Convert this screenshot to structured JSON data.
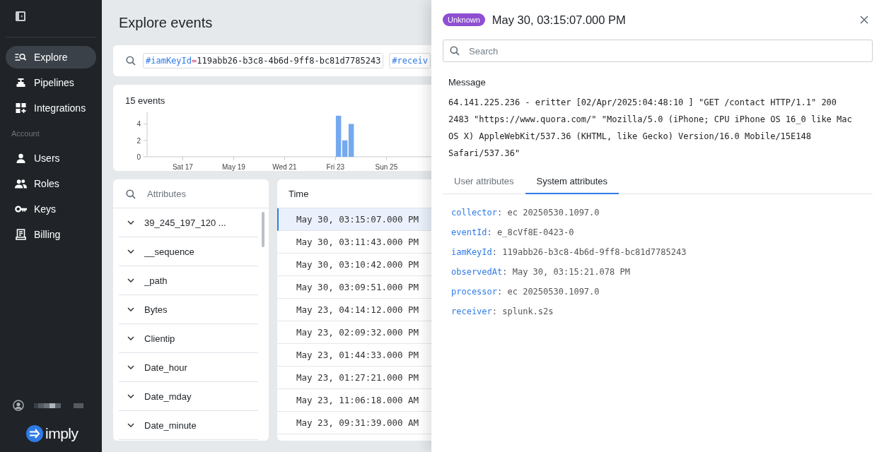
{
  "sidebar": {
    "items": [
      {
        "label": "Explore",
        "selected": true
      },
      {
        "label": "Pipelines",
        "selected": false
      },
      {
        "label": "Integrations",
        "selected": false
      }
    ],
    "section_label": "Account",
    "account_items": [
      {
        "label": "Users",
        "selected": false
      },
      {
        "label": "Roles",
        "selected": false
      },
      {
        "label": "Keys",
        "selected": false
      },
      {
        "label": "Billing",
        "selected": false
      }
    ],
    "logo": "imply"
  },
  "main": {
    "title": "Explore events",
    "filters": [
      {
        "key": "#iamKeyId",
        "op": "=",
        "value": "119abb26-b3c8-4b6d-9ff8-bc81d7785243"
      },
      {
        "key": "#receiv"
      }
    ],
    "histogram": {
      "count": "15 events",
      "chart_data": {
        "type": "bar",
        "categories": [
          null,
          null,
          null,
          null,
          null,
          null,
          "Sat 17",
          null,
          null,
          null,
          null,
          null,
          null,
          null,
          "May 19",
          null,
          null,
          null,
          null,
          null,
          null,
          null,
          "Wed 21",
          null,
          null,
          null,
          null,
          null,
          null,
          null,
          "Fri 23",
          null,
          null,
          null,
          null,
          null,
          null,
          null,
          "Sun 25",
          null,
          null,
          null,
          null,
          null,
          null
        ],
        "series": [
          {
            "color": "#74a9ef",
            "values": [
              null,
              null,
              null,
              null,
              null,
              null,
              null,
              null,
              null,
              null,
              null,
              null,
              null,
              null,
              null,
              null,
              null,
              null,
              null,
              null,
              null,
              null,
              null,
              null,
              null,
              null,
              null,
              null,
              null,
              null,
              5,
              2,
              4,
              null,
              null,
              null,
              null,
              null,
              null,
              null,
              null,
              null,
              null,
              null,
              null
            ]
          }
        ],
        "ylim": [
          0,
          5.5
        ],
        "yticks": [
          0,
          2,
          4
        ]
      }
    },
    "attributes": {
      "placeholder": "Attributes",
      "items": [
        "39_245_197_120 ...",
        "__sequence",
        "_path",
        "Bytes",
        "Clientip",
        "Date_hour",
        "Date_mday",
        "Date_minute"
      ]
    },
    "events": {
      "columns": [
        "Time"
      ],
      "rows": [
        {
          "time": "May 30, 03:15:07.000 PM",
          "selected": true
        },
        {
          "time": "May 30, 03:11:43.000 PM",
          "selected": false
        },
        {
          "time": "May 30, 03:10:42.000 PM",
          "selected": false
        },
        {
          "time": "May 30, 03:09:51.000 PM",
          "selected": false
        },
        {
          "time": "May 23, 04:14:12.000 PM",
          "selected": false
        },
        {
          "time": "May 23, 02:09:32.000 PM",
          "selected": false
        },
        {
          "time": "May 23, 01:44:33.000 PM",
          "selected": false
        },
        {
          "time": "May 23, 01:27:21.000 PM",
          "selected": false
        },
        {
          "time": "May 23, 11:06:18.000 AM",
          "selected": false
        },
        {
          "time": "May 23, 09:31:39.000 AM",
          "selected": false
        }
      ]
    }
  },
  "drawer": {
    "badge": "Unknown",
    "title": "May 30, 03:15:07.000 PM",
    "search": {
      "placeholder": "Search"
    },
    "message_label": "Message",
    "message": "64.141.225.236 - eritter [02/Apr/2025:04:48:10 ] \"GET /contact HTTP/1.1\" 200 2483 \"https://www.quora.com/\" \"Mozilla/5.0 (iPhone; CPU iPhone OS 16_0 like Mac OS X) AppleWebKit/537.36 (KHTML, like Gecko) Version/16.0 Mobile/15E148 Safari/537.36\"",
    "tabs": [
      {
        "label": "User attributes",
        "selected": false
      },
      {
        "label": "System attributes",
        "selected": true
      }
    ],
    "attributes": [
      {
        "key": "collector",
        "sep": ":",
        "value": "ec 20250530.1097.0"
      },
      {
        "key": "eventId",
        "sep": ":",
        "value": "e_8cVf8E-0423-0"
      },
      {
        "key": "iamKeyId",
        "sep": ":",
        "value": "119abb26-b3c8-4b6d-9ff8-bc81d7785243"
      },
      {
        "key": "observedAt",
        "sep": ":",
        "value": "May 30, 03:15:21.078 PM"
      },
      {
        "key": "processor",
        "sep": ":",
        "value": "ec 20250530.1097.0"
      },
      {
        "key": "receiver",
        "sep": ":",
        "value": "splunk.s2s"
      }
    ]
  }
}
